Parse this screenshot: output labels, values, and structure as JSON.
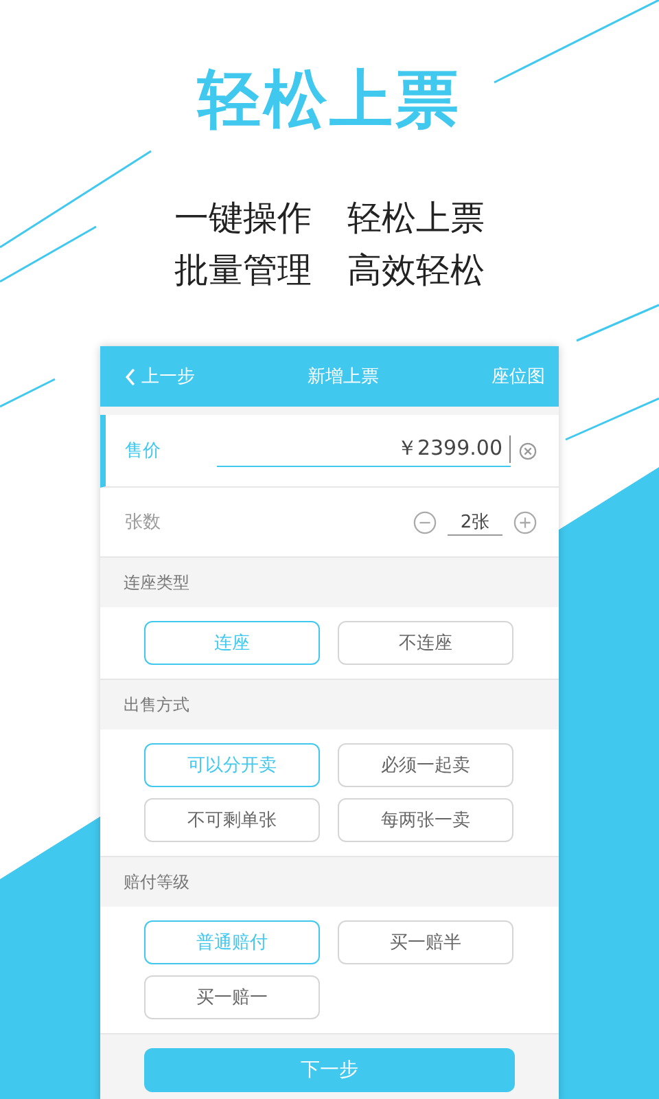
{
  "headline": "轻松上票",
  "taglines": [
    [
      "一键操作",
      "轻松上票"
    ],
    [
      "批量管理",
      "高效轻松"
    ]
  ],
  "phone": {
    "nav": {
      "back": "上一步",
      "title": "新增上票",
      "action": "座位图"
    },
    "price": {
      "label": "售价",
      "value": "￥2399.00"
    },
    "quantity": {
      "label": "张数",
      "value": "2张"
    },
    "sections": [
      {
        "title": "连座类型",
        "options": [
          {
            "label": "连座",
            "selected": true
          },
          {
            "label": "不连座",
            "selected": false
          }
        ]
      },
      {
        "title": "出售方式",
        "options": [
          {
            "label": "可以分开卖",
            "selected": true
          },
          {
            "label": "必须一起卖",
            "selected": false
          },
          {
            "label": "不可剩单张",
            "selected": false
          },
          {
            "label": "每两张一卖",
            "selected": false
          }
        ]
      },
      {
        "title": "赔付等级",
        "options": [
          {
            "label": "普通赔付",
            "selected": true
          },
          {
            "label": "买一赔半",
            "selected": false
          },
          {
            "label": "买一赔一",
            "selected": false
          }
        ]
      }
    ],
    "next_button": "下一步"
  }
}
